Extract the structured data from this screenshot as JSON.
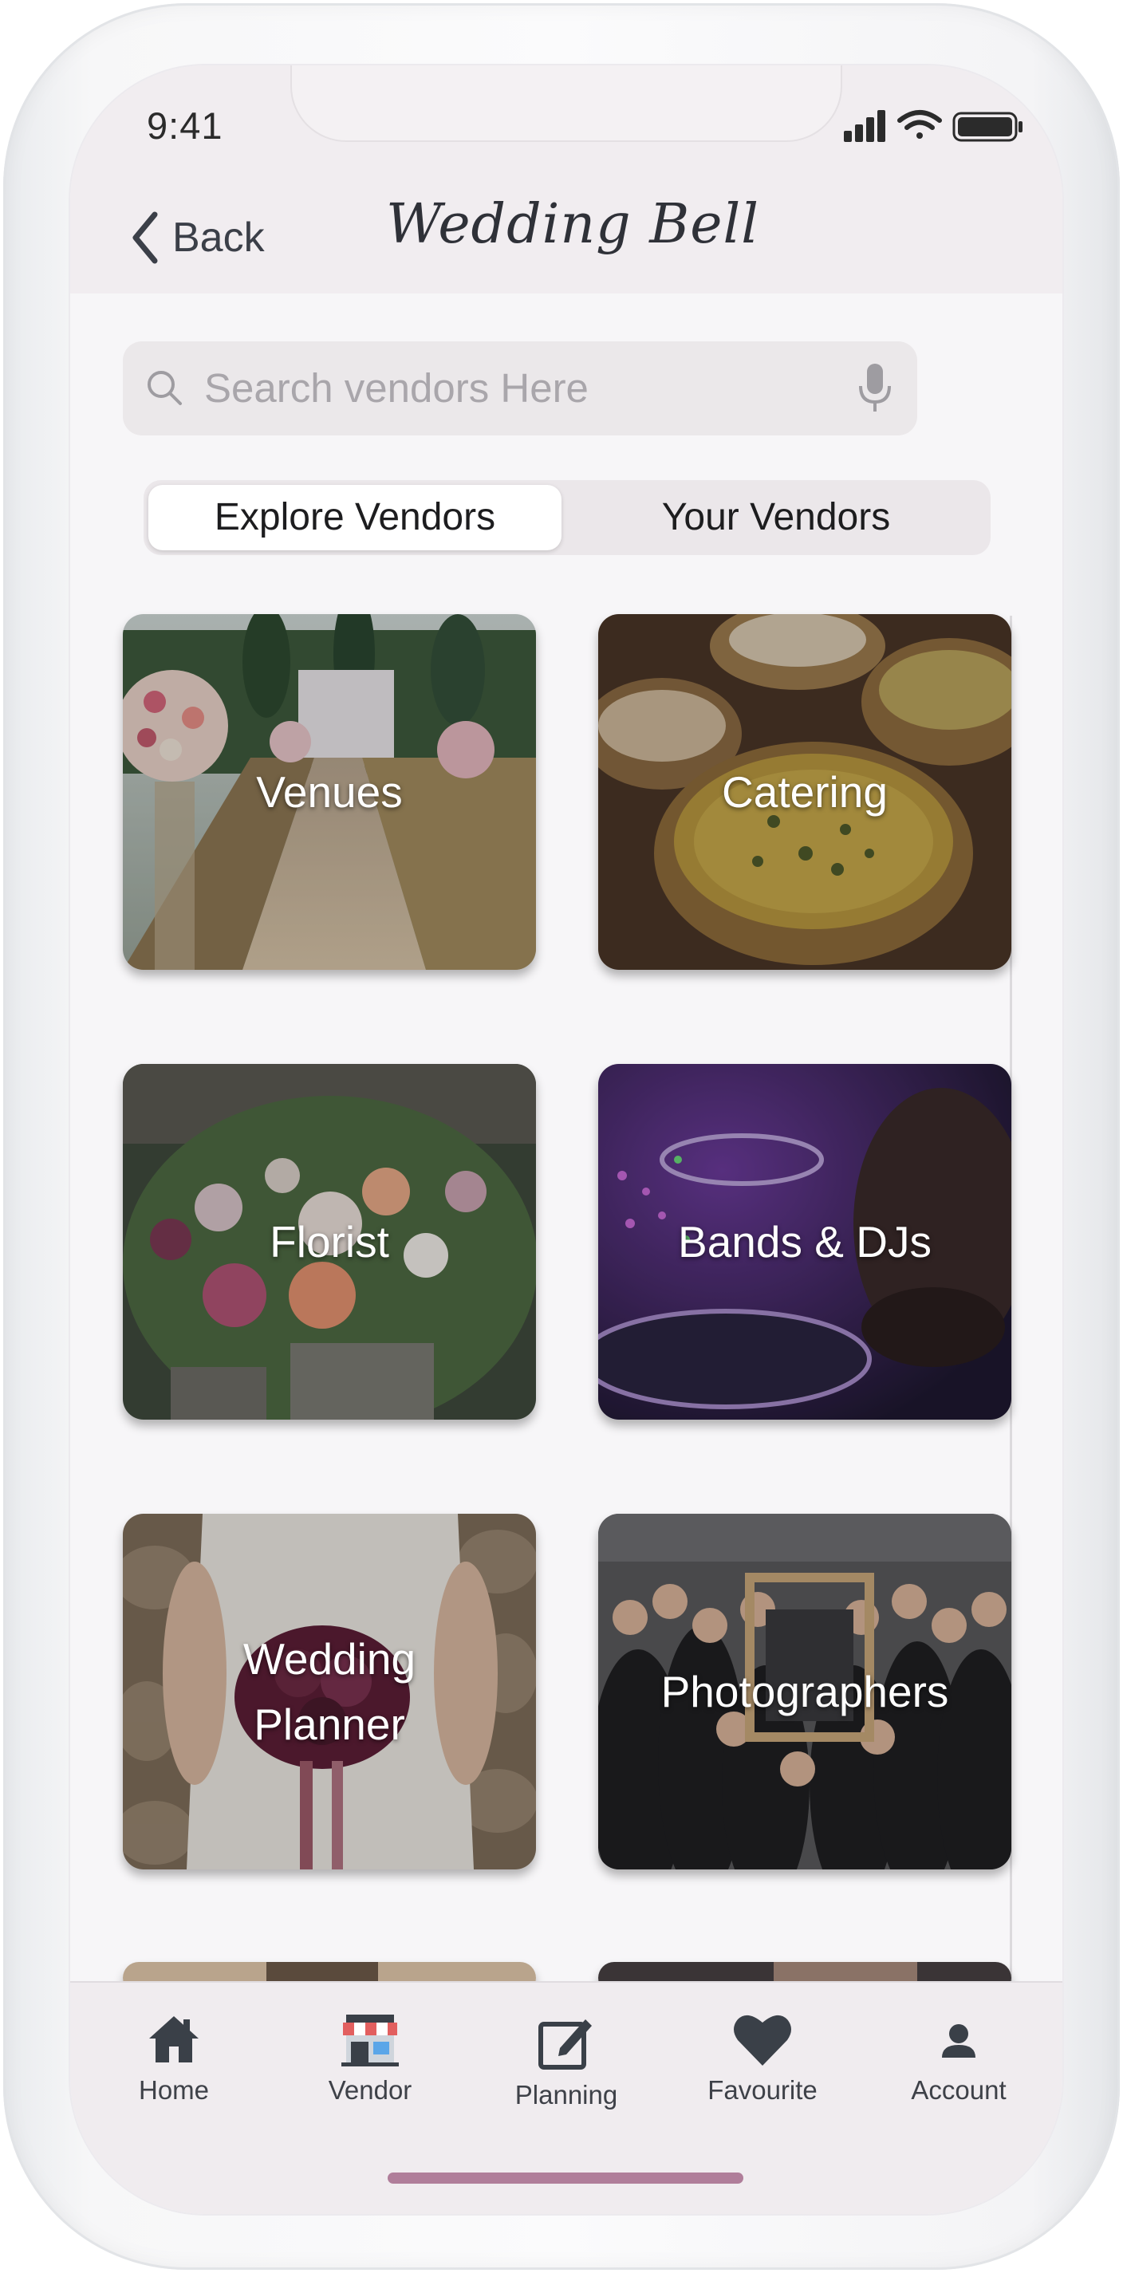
{
  "status_bar": {
    "time": "9:41",
    "icons": [
      "signal-icon",
      "wifi-icon",
      "battery-icon"
    ]
  },
  "header": {
    "back_label": "Back",
    "title": "Wedding Bell",
    "back_icon": "chevron-left-icon"
  },
  "search": {
    "placeholder": "Search vendors Here",
    "icon": "search-icon",
    "mic_icon": "microphone-icon"
  },
  "segments": {
    "active": "Explore Vendors",
    "inactive": "Your Vendors"
  },
  "categories": [
    {
      "label": "Venues"
    },
    {
      "label": "Catering"
    },
    {
      "label": "Florist"
    },
    {
      "label": "Bands & DJs"
    },
    {
      "label": "Wedding\nPlanner"
    },
    {
      "label": "Photographers"
    }
  ],
  "tabbar": {
    "items": [
      {
        "label": "Home",
        "icon": "home-icon"
      },
      {
        "label": "Vendor",
        "icon": "store-icon"
      },
      {
        "label": "Planning",
        "icon": "edit-icon"
      },
      {
        "label": "Favourite",
        "icon": "heart-icon"
      },
      {
        "label": "Account",
        "icon": "user-icon"
      }
    ]
  },
  "colors": {
    "accent": "#b07e9a",
    "header_bg": "#f1edf0",
    "text_dark": "#3e4148"
  }
}
